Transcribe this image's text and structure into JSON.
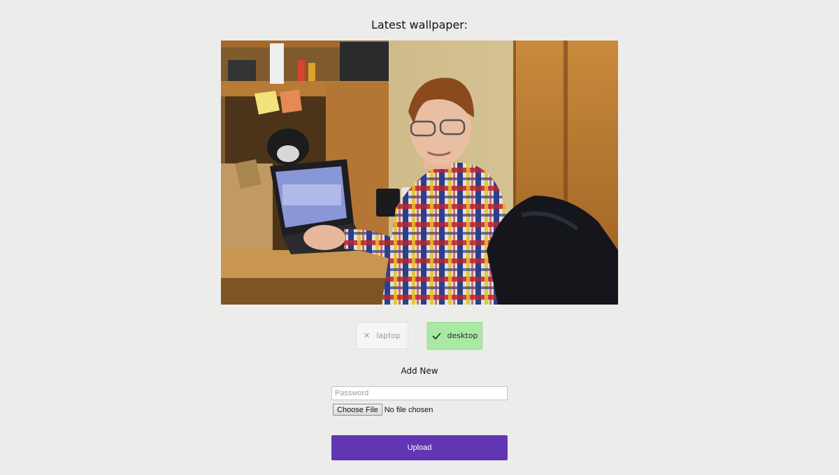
{
  "header": {
    "title": "Latest wallpaper:"
  },
  "wallpaper": {
    "alt": "Person in plaid shirt at a laptop on a desk"
  },
  "devices": [
    {
      "label": "laptop",
      "selected": false,
      "icon": "close-icon"
    },
    {
      "label": "desktop",
      "selected": true,
      "icon": "checkmark-icon"
    }
  ],
  "add_new": {
    "title": "Add New",
    "password_placeholder": "Password",
    "file_button_label": "Choose File",
    "file_status": "No file chosen",
    "upload_label": "Upload"
  },
  "colors": {
    "background": "#ecedeb",
    "selected_toggle": "#a9e9a4",
    "upload_button": "#6236b3"
  }
}
